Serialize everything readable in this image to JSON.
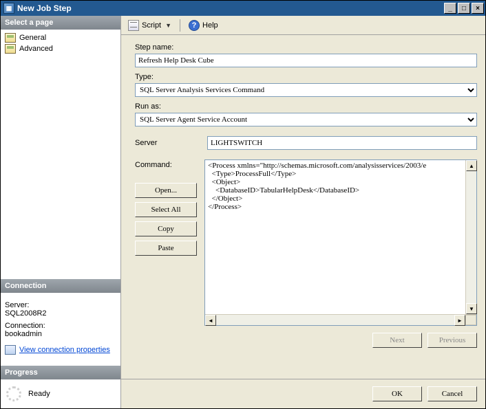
{
  "window": {
    "title": "New Job Step"
  },
  "winbuttons": {
    "min": "_",
    "max": "□",
    "close": "×"
  },
  "left": {
    "selectPageHeader": "Select a page",
    "nav": [
      {
        "label": "General"
      },
      {
        "label": "Advanced"
      }
    ],
    "connectionHeader": "Connection",
    "serverLabel": "Server:",
    "serverValue": "SQL2008R2",
    "connLabel": "Connection:",
    "connValue": "bookadmin",
    "viewConnLink": "View connection properties",
    "progressHeader": "Progress",
    "progressText": "Ready"
  },
  "toolbar": {
    "script": "Script",
    "help": "Help"
  },
  "form": {
    "stepNameLabel": "Step name:",
    "stepNameValue": "Refresh Help Desk Cube",
    "typeLabel": "Type:",
    "typeValue": "SQL Server Analysis Services Command",
    "runAsLabel": "Run as:",
    "runAsValue": "SQL Server Agent Service Account",
    "serverLabel": "Server",
    "serverValue": "LIGHTSWITCH",
    "commandLabel": "Command:",
    "commandValue": "<Process xmlns=\"http://schemas.microsoft.com/analysisservices/2003/e\n  <Type>ProcessFull</Type>\n  <Object>\n    <DatabaseID>TabularHelpDesk</DatabaseID>\n  </Object>\n</Process>",
    "buttons": {
      "open": "Open...",
      "selectAll": "Select All",
      "copy": "Copy",
      "paste": "Paste"
    },
    "nav": {
      "next": "Next",
      "previous": "Previous"
    }
  },
  "footer": {
    "ok": "OK",
    "cancel": "Cancel"
  }
}
